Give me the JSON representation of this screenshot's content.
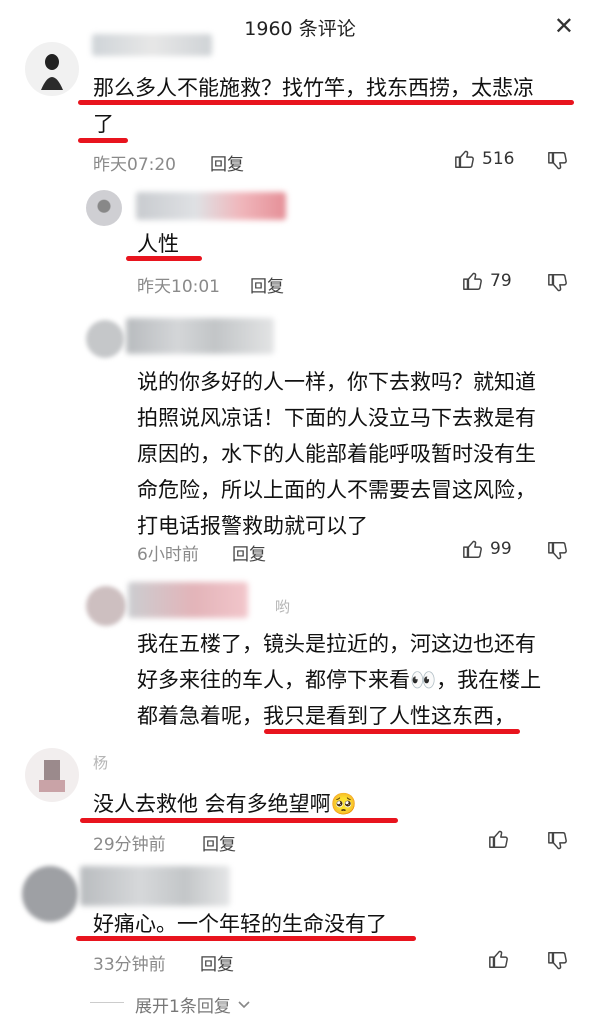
{
  "header": {
    "title": "1960 条评论",
    "close": "✕"
  },
  "comments": [
    {
      "text_lines": [
        "那么多人不能施救？找竹竿，找东西捞，太悲凉",
        "了"
      ],
      "time": "昨天07:20",
      "reply": "回复",
      "likes": "516"
    },
    {
      "text_lines": [
        "人性"
      ],
      "time": "昨天10:01",
      "reply": "回复",
      "likes": "79"
    },
    {
      "text_lines": [
        "说的你多好的人一样，你下去救吗？就知道",
        "拍照说风凉话！下面的人没立马下去救是有",
        "原因的，水下的人能部着能呼吸暂时没有生",
        "命危险，所以上面的人不需要去冒这风险，",
        "打电话报警救助就可以了"
      ],
      "time": "6小时前",
      "reply": "回复",
      "likes": "99"
    },
    {
      "name_fragment": "哟",
      "text_lines": [
        "我在五楼了，镜头是拉近的，河这边也还有",
        "好多来往的车人，都停下来看👀，我在楼上",
        "都着急着呢，我只是看到了人性这东西，"
      ]
    },
    {
      "name_fragment": "杨",
      "text_lines": [
        "没人去救他  会有多绝望啊🥺"
      ],
      "time": "29分钟前",
      "reply": "回复"
    },
    {
      "text_lines": [
        "好痛心。一个年轻的生命没有了"
      ],
      "time": "33分钟前",
      "reply": "回复"
    }
  ],
  "expand_replies": "展开1条回复"
}
